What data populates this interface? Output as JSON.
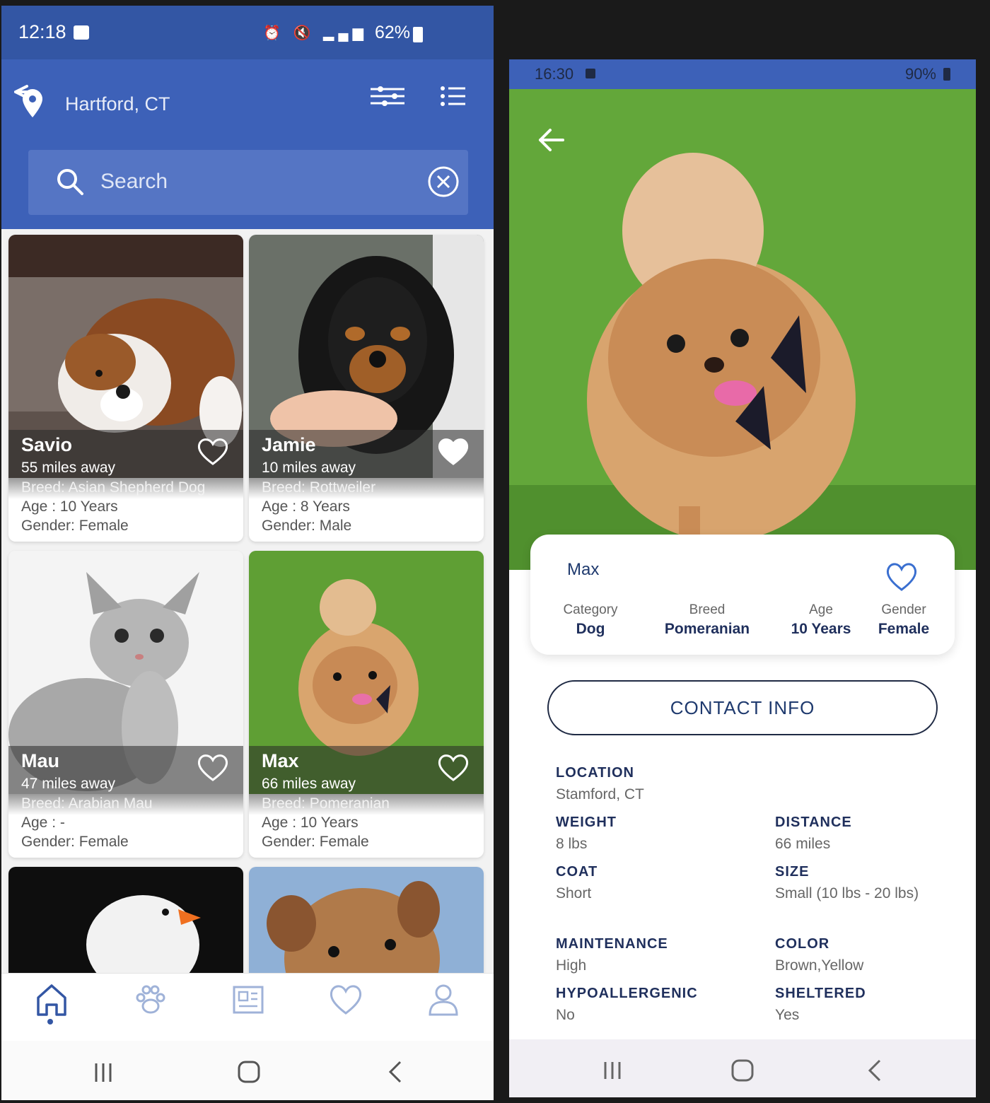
{
  "left": {
    "status": {
      "time": "12:18",
      "battery": "62%"
    },
    "location": "Hartford, CT",
    "search": {
      "placeholder": "Search"
    },
    "pets": [
      {
        "name": "Savio",
        "distance": "55 miles away",
        "breed": "Breed: Asian Shepherd Dog",
        "age": "Age : 10 Years",
        "gender": "Gender: Female",
        "favorited": false
      },
      {
        "name": "Jamie",
        "distance": "10 miles away",
        "breed": "Breed: Rottweiler",
        "age": "Age : 8 Years",
        "gender": "Gender: Male",
        "favorited": true
      },
      {
        "name": "Mau",
        "distance": "47 miles away",
        "breed": "Breed: Arabian Mau",
        "age": "Age : -",
        "gender": "Gender: Female",
        "favorited": false
      },
      {
        "name": "Max",
        "distance": "66 miles away",
        "breed": "Breed: Pomeranian",
        "age": "Age : 10 Years",
        "gender": "Gender: Female",
        "favorited": false
      }
    ],
    "bottom_nav": [
      "home-icon",
      "paw-icon",
      "news-icon",
      "heart-icon",
      "profile-icon"
    ],
    "active_tab": "home-icon"
  },
  "right": {
    "status": {
      "time": "16:30",
      "battery": "90%"
    },
    "pet": {
      "name": "Max",
      "category_label": "Category",
      "category": "Dog",
      "breed_label": "Breed",
      "breed": "Pomeranian",
      "age_label": "Age",
      "age": "10 Years",
      "gender_label": "Gender",
      "gender": "Female"
    },
    "contact_label": "CONTACT INFO",
    "details": {
      "location_label": "LOCATION",
      "location": "Stamford, CT",
      "weight_label": "WEIGHT",
      "weight": "8 lbs",
      "distance_label": "DISTANCE",
      "distance": "66 miles",
      "coat_label": "COAT",
      "coat": "Short",
      "size_label": "SIZE",
      "size": "Small (10 lbs - 20 lbs)",
      "maintenance_label": "MAINTENANCE",
      "maintenance": "High",
      "color_label": "COLOR",
      "color": "Brown,Yellow",
      "hypoallergenic_label": "HYPOALLERGENIC",
      "hypoallergenic": "No",
      "sheltered_label": "SHELTERED",
      "sheltered": "Yes"
    }
  },
  "colors": {
    "primary": "#3d61b8",
    "status_bar": "#3356a4",
    "navy_text": "#1f2f5c"
  }
}
